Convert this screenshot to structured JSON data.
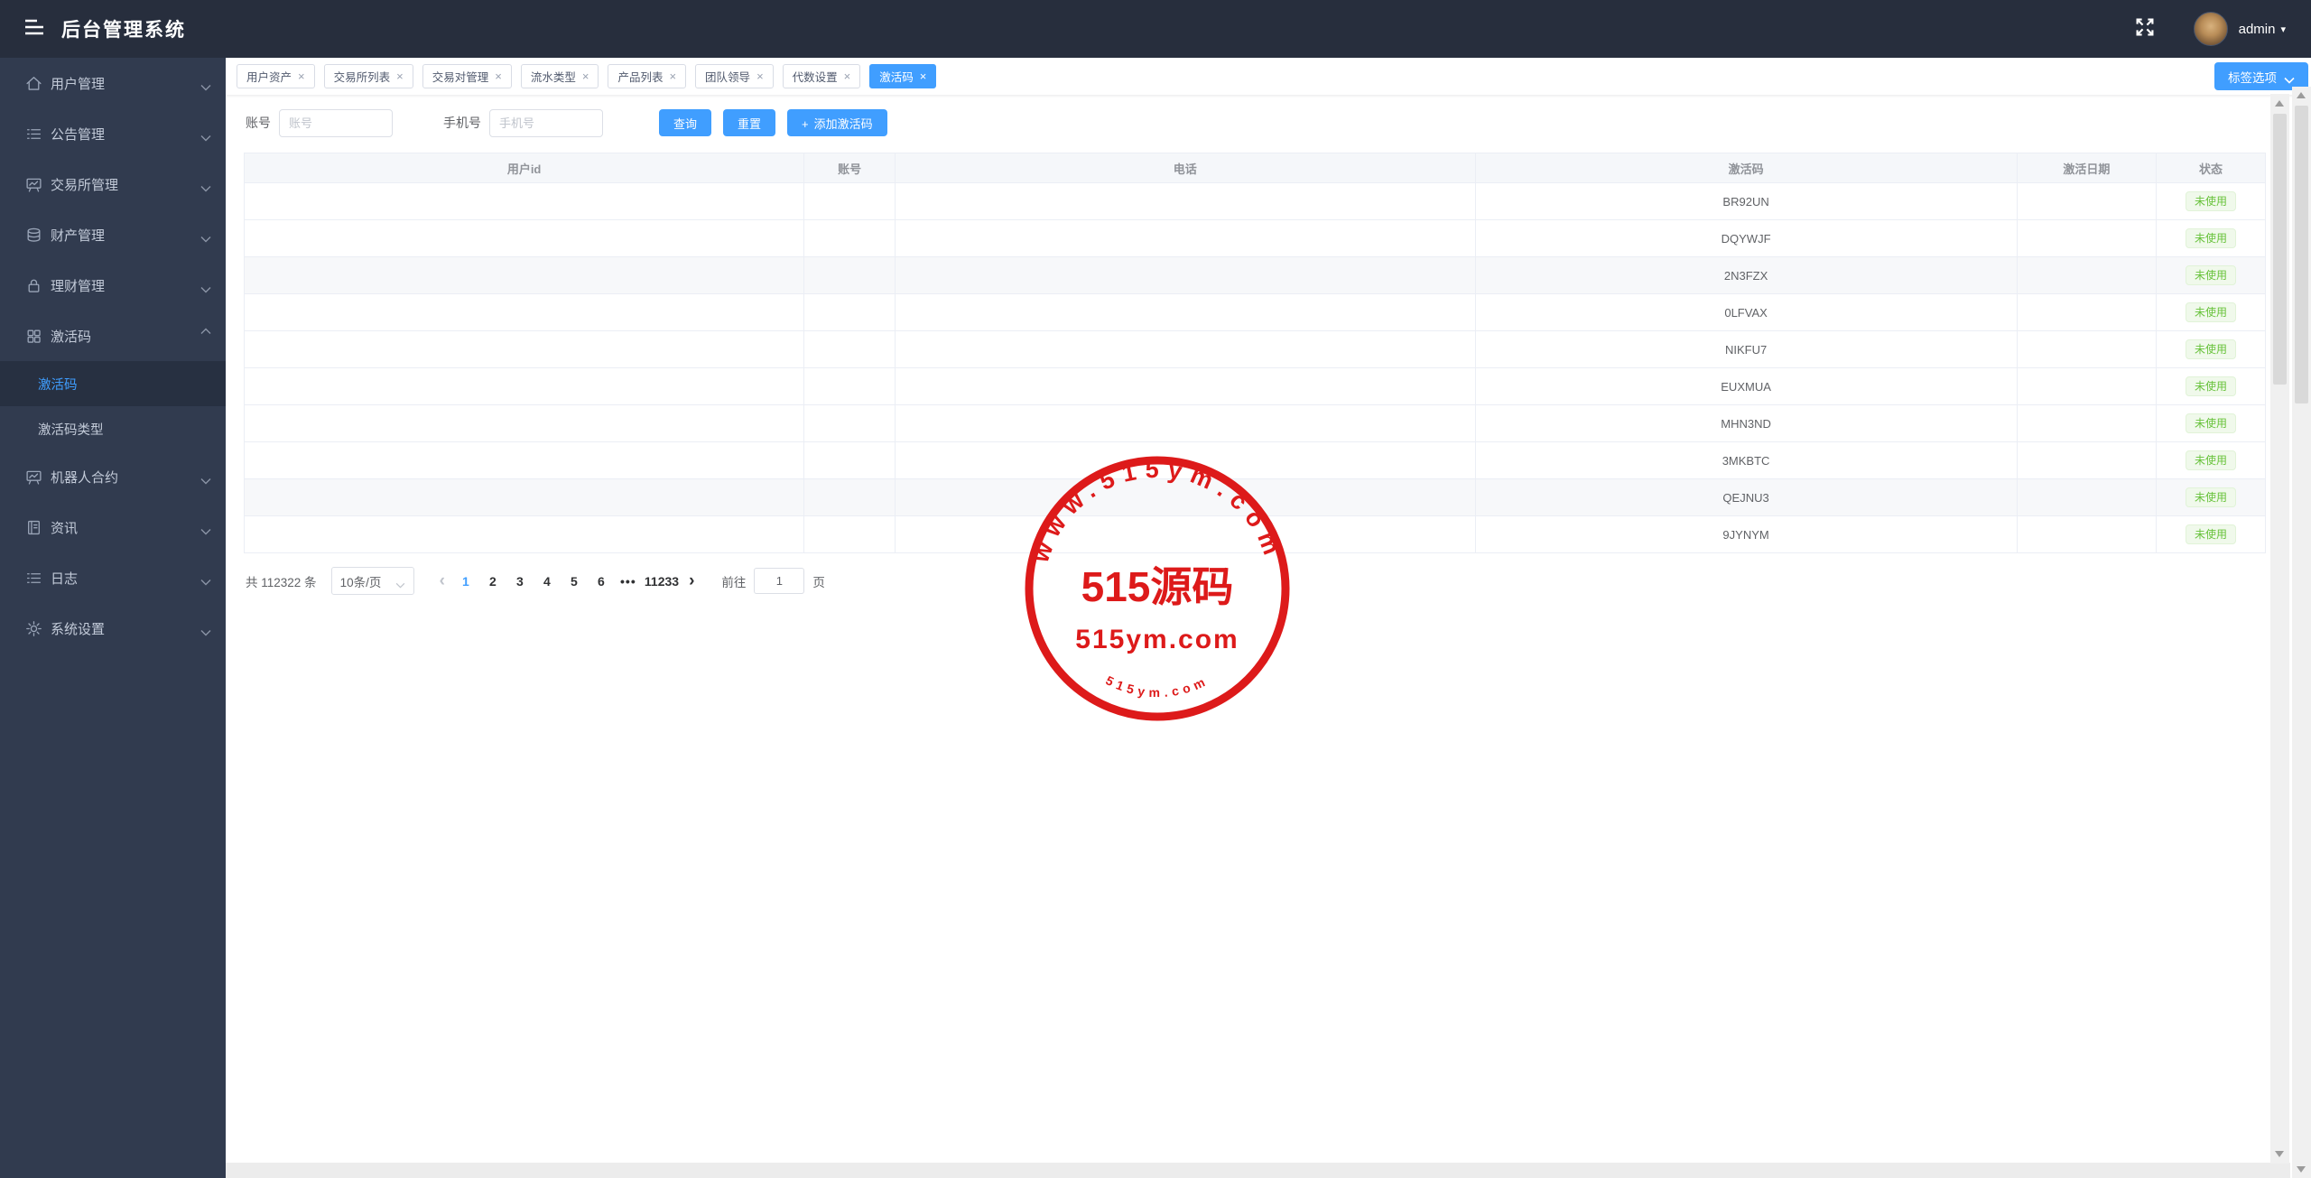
{
  "app": {
    "title": "后台管理系统",
    "user": "admin"
  },
  "sidebar": {
    "items": [
      {
        "label": "用户管理",
        "icon": "home-icon",
        "expanded": false
      },
      {
        "label": "公告管理",
        "icon": "list-icon",
        "expanded": false
      },
      {
        "label": "交易所管理",
        "icon": "board-chart-icon",
        "expanded": false
      },
      {
        "label": "财产管理",
        "icon": "coins-icon",
        "expanded": false
      },
      {
        "label": "理财管理",
        "icon": "lock-icon",
        "expanded": false
      },
      {
        "label": "激活码",
        "icon": "grid-icon",
        "expanded": true,
        "children": [
          {
            "label": "激活码",
            "active": true
          },
          {
            "label": "激活码类型",
            "active": false
          }
        ]
      },
      {
        "label": "机器人合约",
        "icon": "board-chart-icon",
        "expanded": false
      },
      {
        "label": "资讯",
        "icon": "notebook-icon",
        "expanded": false
      },
      {
        "label": "日志",
        "icon": "list-icon",
        "expanded": false
      },
      {
        "label": "系统设置",
        "icon": "gear-icon",
        "expanded": false
      }
    ]
  },
  "tabs": {
    "items": [
      {
        "label": "用户资产",
        "active": false
      },
      {
        "label": "交易所列表",
        "active": false
      },
      {
        "label": "交易对管理",
        "active": false
      },
      {
        "label": "流水类型",
        "active": false
      },
      {
        "label": "产品列表",
        "active": false
      },
      {
        "label": "团队领导",
        "active": false
      },
      {
        "label": "代数设置",
        "active": false
      },
      {
        "label": "激活码",
        "active": true
      }
    ],
    "options_button": "标签选项"
  },
  "filters": {
    "account_label": "账号",
    "account_placeholder": "账号",
    "phone_label": "手机号",
    "phone_placeholder": "手机号",
    "search_label": "查询",
    "reset_label": "重置",
    "add_label": "添加激活码"
  },
  "table": {
    "columns": [
      "用户id",
      "账号",
      "电话",
      "激活码",
      "激活日期",
      "状态"
    ],
    "rows": [
      {
        "userid": "",
        "account": "",
        "phone": "",
        "code": "BR92UN",
        "date": "",
        "status": "未使用"
      },
      {
        "userid": "",
        "account": "",
        "phone": "",
        "code": "DQYWJF",
        "date": "",
        "status": "未使用"
      },
      {
        "userid": "",
        "account": "",
        "phone": "",
        "code": "2N3FZX",
        "date": "",
        "status": "未使用"
      },
      {
        "userid": "",
        "account": "",
        "phone": "",
        "code": "0LFVAX",
        "date": "",
        "status": "未使用"
      },
      {
        "userid": "",
        "account": "",
        "phone": "",
        "code": "NIKFU7",
        "date": "",
        "status": "未使用"
      },
      {
        "userid": "",
        "account": "",
        "phone": "",
        "code": "EUXMUA",
        "date": "",
        "status": "未使用"
      },
      {
        "userid": "",
        "account": "",
        "phone": "",
        "code": "MHN3ND",
        "date": "",
        "status": "未使用"
      },
      {
        "userid": "",
        "account": "",
        "phone": "",
        "code": "3MKBTC",
        "date": "",
        "status": "未使用"
      },
      {
        "userid": "",
        "account": "",
        "phone": "",
        "code": "QEJNU3",
        "date": "",
        "status": "未使用"
      },
      {
        "userid": "",
        "account": "",
        "phone": "",
        "code": "9JYNYM",
        "date": "",
        "status": "未使用"
      }
    ]
  },
  "pagination": {
    "total_text": "共 112322 条",
    "page_size": "10条/页",
    "pages": [
      "1",
      "2",
      "3",
      "4",
      "5",
      "6",
      "•••",
      "11233"
    ],
    "active_page": "1",
    "prev": "‹",
    "next": "›",
    "goto_label": "前往",
    "goto_value": "1",
    "page_suffix": "页"
  },
  "stamp": {
    "top_text": "www.515ym.com",
    "center_text": "515源码",
    "mid_text": "515ym.com",
    "bottom_text": "515ym.com",
    "color": "#dd1a1a"
  },
  "colors": {
    "accent": "#409eff",
    "success": "#67c23a",
    "header_bg": "#272e3d",
    "sidebar_bg": "#313b4f"
  }
}
